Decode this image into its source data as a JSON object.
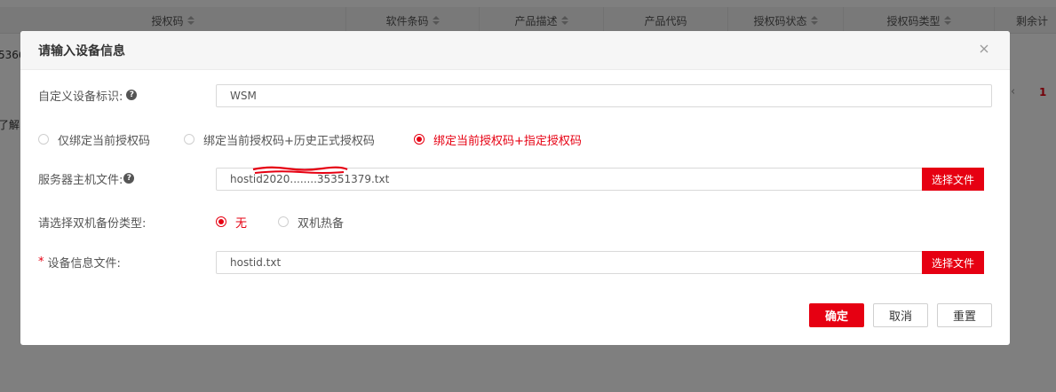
{
  "background": {
    "columns": [
      {
        "label": "授权码",
        "sortable": true
      },
      {
        "label": "软件条码",
        "sortable": true
      },
      {
        "label": "产品描述",
        "sortable": true
      },
      {
        "label": "产品代码",
        "sortable": false
      },
      {
        "label": "授权码状态",
        "sortable": true
      },
      {
        "label": "授权码类型",
        "sortable": true
      },
      {
        "label": "剩余计",
        "sortable": false
      }
    ],
    "row_fragment": "5366",
    "left_fragment": "了解",
    "pager_prev": "‹",
    "pager_current": "1"
  },
  "modal": {
    "title": "请输入设备信息",
    "device_id_label": "自定义设备标识:",
    "device_id_value": "WSM",
    "bind_options": [
      {
        "label": "仅绑定当前授权码",
        "checked": false
      },
      {
        "label": "绑定当前授权码+历史正式授权码",
        "checked": false
      },
      {
        "label": "绑定当前授权码+指定授权码",
        "checked": true
      }
    ],
    "host_file_label": "服务器主机文件:",
    "host_file_value": "hostid2020........35351379.txt",
    "select_file_label": "选择文件",
    "backup_label": "请选择双机备份类型:",
    "backup_options": [
      {
        "label": "无",
        "checked": true
      },
      {
        "label": "双机热备",
        "checked": false
      }
    ],
    "device_file_required": "*",
    "device_file_label": "设备信息文件:",
    "device_file_value": "hostid.txt",
    "confirm_label": "确定",
    "cancel_label": "取消",
    "reset_label": "重置"
  },
  "colors": {
    "accent": "#e60012",
    "overlay": "#000000"
  }
}
